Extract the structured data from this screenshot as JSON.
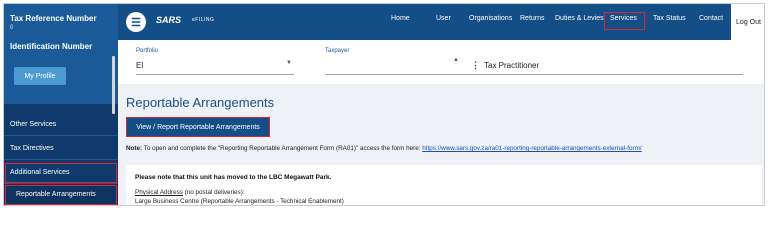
{
  "sidebar": {
    "tax_ref_label": "Tax Reference Number",
    "tax_ref_value": "0",
    "identification_label": "Identification Number",
    "profile_button": "My Profile",
    "items": [
      {
        "label": "Other Services"
      },
      {
        "label": "Tax Directives"
      },
      {
        "label": "Additional Services"
      },
      {
        "label": "Reportable Arrangements"
      }
    ]
  },
  "topnav": {
    "logo": "SARS",
    "logo_sub": "eFILING",
    "items": [
      {
        "label": "Home"
      },
      {
        "label": "User"
      },
      {
        "label": "Organisations"
      },
      {
        "label": "Returns"
      },
      {
        "label": "Duties & Levies"
      },
      {
        "label": "Services"
      },
      {
        "label": "Tax Status"
      },
      {
        "label": "Contact"
      }
    ],
    "logout": "Log Out"
  },
  "selector": {
    "portfolio_label": "Portfolio",
    "portfolio_value": "El",
    "taxpayer_label": "Taxpayer",
    "taxpayer_value": "Tax Practitioner"
  },
  "main": {
    "title": "Reportable Arrangements",
    "report_button": "View / Report Reportable Arrangements",
    "note_label": "Note:",
    "note_text": " To open and complete the \"Reporting Reportable Arrangement Form (RA01)\" access the form here: ",
    "note_link": "https://www.sars.gov.za/ra01-reporting-reportable-arrangements-external-form/",
    "card_title": "Please note that this unit has moved to the LBC Megawatt Park.",
    "physical_address_label": "Physical Address",
    "physical_address_note": " (no postal deliveries):",
    "address_line": "Large Business Centre (Reportable Arrangements - Technical Enablement)"
  },
  "colors": {
    "nav_bg": "#144e86",
    "sidebar_bg": "#0f3a6b",
    "highlight": "#e2232f",
    "link": "#1a4fb8"
  }
}
